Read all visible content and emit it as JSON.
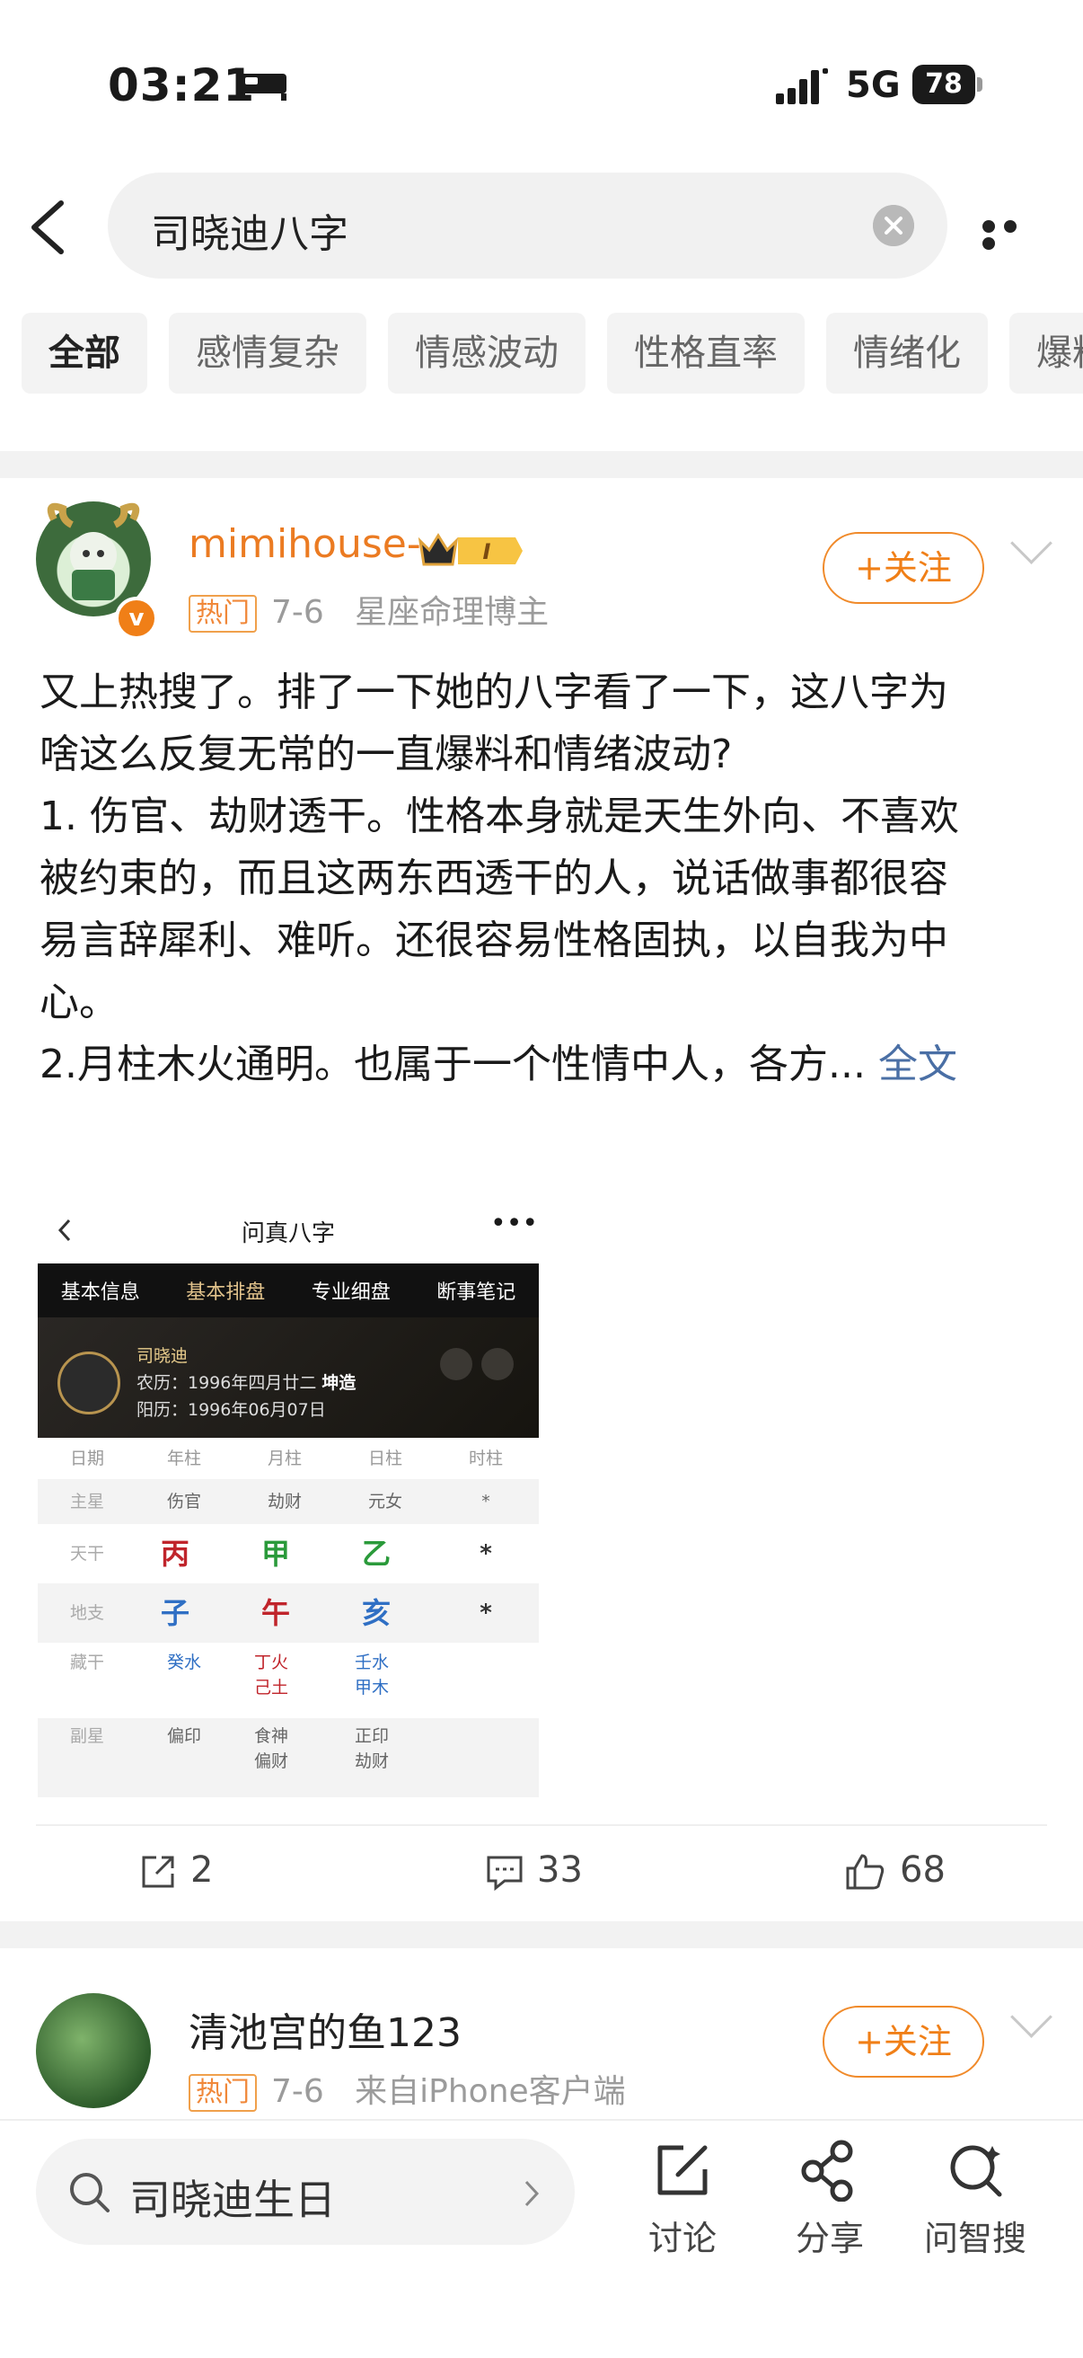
{
  "status_bar": {
    "time": "03:21",
    "network": "5G",
    "battery": "78"
  },
  "search": {
    "query": "司晓迪八字"
  },
  "chips": [
    "全部",
    "感情复杂",
    "情感波动",
    "性格直率",
    "情绪化",
    "爆料"
  ],
  "post1": {
    "username": "mimihouse-",
    "vip_level": "I",
    "hot_tag": "热门",
    "date": "7-6",
    "description": "星座命理博主",
    "follow_label": "+关注",
    "text_lines": [
      "又上热搜了。排了一下她的八字看了一下，这八字为",
      "啥这么反复无常的一直爆料和情绪波动?",
      "1. 伤官、劫财透干。性格本身就是天生外向、不喜欢",
      "被约束的，而且这两东西透干的人，说话做事都很容",
      "易言辞犀利、难听。还很容易性格固执，以自我为中",
      "心。",
      "2.月柱木火通明。也属于一个性情中人，各方..."
    ],
    "full_text_link": "全文",
    "image": {
      "title": "问真八字",
      "nav": [
        "基本信息",
        "基本排盘",
        "专业细盘",
        "断事笔记"
      ],
      "name": "司晓迪",
      "lunar": "农历：1996年四月廿二",
      "gender_tag": "坤造",
      "solar": "阳历：1996年06月07日",
      "headers": [
        "日期",
        "年柱",
        "月柱",
        "日柱",
        "时柱"
      ],
      "rows": [
        {
          "label": "主星",
          "cells": [
            "伤官",
            "劫财",
            "元女",
            "*"
          ]
        },
        {
          "label": "天干",
          "cells": [
            "丙",
            "甲",
            "乙",
            "*"
          ]
        },
        {
          "label": "地支",
          "cells": [
            "子",
            "午",
            "亥",
            "*"
          ]
        },
        {
          "label": "藏干",
          "cells": [
            "癸水",
            "丁火 己土",
            "壬水 甲木",
            ""
          ]
        },
        {
          "label": "副星",
          "cells": [
            "偏印",
            "食神 偏财",
            "正印 劫财",
            ""
          ]
        }
      ]
    },
    "actions": {
      "repost": "2",
      "comment": "33",
      "like": "68"
    }
  },
  "post2": {
    "username": "清池宫的鱼123",
    "hot_tag": "热门",
    "date": "7-6",
    "source": "来自iPhone客户端",
    "follow_label": "+关注"
  },
  "bottom": {
    "search_text": "司晓迪生日",
    "actions": [
      "讨论",
      "分享",
      "问智搜"
    ]
  },
  "colors": {
    "accent": "#f07f17",
    "link": "#4a6fa5",
    "username": "#eb7b22"
  }
}
